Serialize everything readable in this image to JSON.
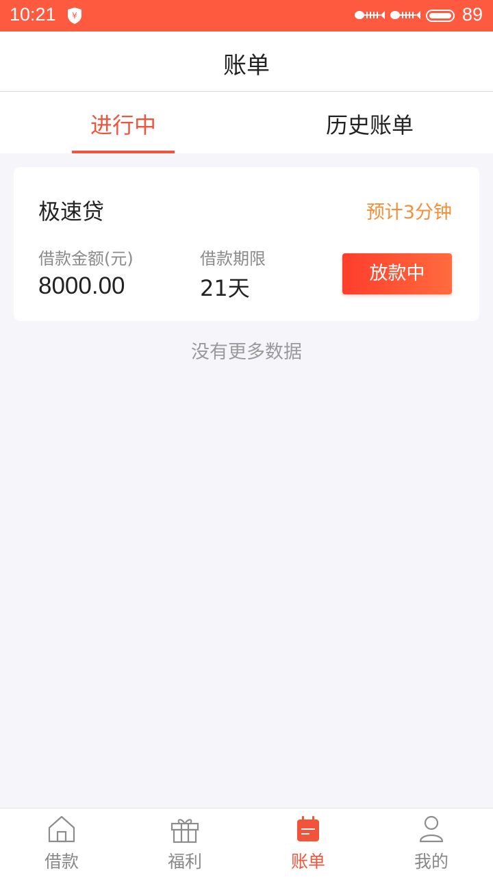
{
  "status_bar": {
    "time": "10:21",
    "battery_level": "89",
    "icons": [
      "shield-yuan-icon",
      "fish-notification-icon",
      "fish-notification-icon",
      "battery-icon"
    ]
  },
  "header": {
    "title": "账单"
  },
  "tabs": [
    {
      "label": "进行中",
      "active": true
    },
    {
      "label": "历史账单",
      "active": false
    }
  ],
  "bill_card": {
    "product_name": "极速贷",
    "eta": "预计3分钟",
    "amount_label": "借款金额(元)",
    "amount_value": "8000.00",
    "term_label": "借款期限",
    "term_value": "21天",
    "status_button": "放款中"
  },
  "list_footer": "没有更多数据",
  "bottom_nav": [
    {
      "label": "借款",
      "icon": "home-icon",
      "active": false
    },
    {
      "label": "福利",
      "icon": "gift-icon",
      "active": false
    },
    {
      "label": "账单",
      "icon": "bill-icon",
      "active": true
    },
    {
      "label": "我的",
      "icon": "user-icon",
      "active": false
    }
  ],
  "colors": {
    "status_bar": "#fd5a40",
    "accent": "#f2543b",
    "eta_orange": "#f2903a",
    "background": "#f6f6fa"
  }
}
